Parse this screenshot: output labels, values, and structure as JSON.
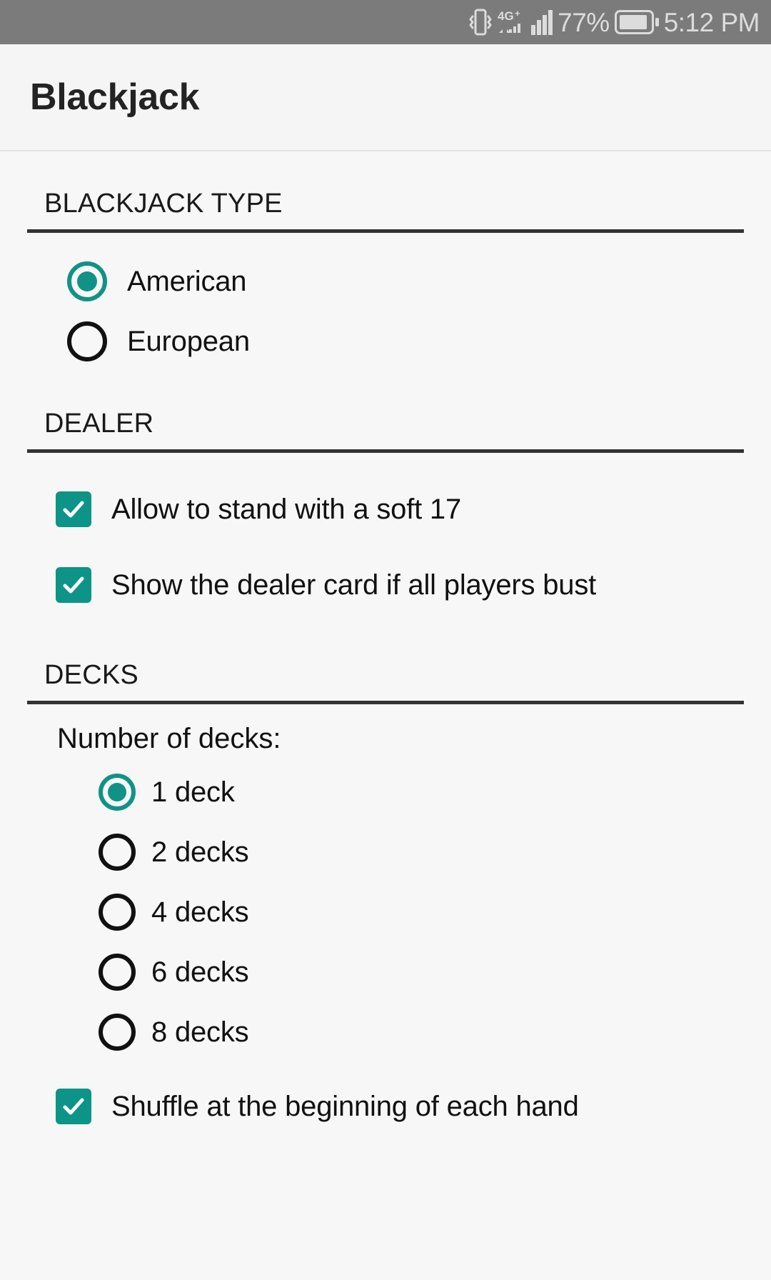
{
  "status_bar": {
    "icons": [
      "vibrate-icon",
      "network-4g-plus-icon",
      "signal-bars-icon",
      "battery-icon"
    ],
    "network_label": "4G",
    "network_superscript": "+",
    "battery_percent": "77%",
    "time": "5:12 PM"
  },
  "app_bar": {
    "title": "Blackjack"
  },
  "sections": {
    "blackjack_type": {
      "header": "BLACKJACK TYPE",
      "options": [
        {
          "label": "American",
          "selected": true
        },
        {
          "label": "European",
          "selected": false
        }
      ]
    },
    "dealer": {
      "header": "DEALER",
      "options": [
        {
          "label": "Allow to stand with a soft 17",
          "checked": true
        },
        {
          "label": "Show the dealer card if all players bust",
          "checked": true
        }
      ]
    },
    "decks": {
      "header": "DECKS",
      "number_label": "Number of decks:",
      "options": [
        {
          "label": "1 deck",
          "selected": true
        },
        {
          "label": "2 decks",
          "selected": false
        },
        {
          "label": "4 decks",
          "selected": false
        },
        {
          "label": "6 decks",
          "selected": false
        },
        {
          "label": "8 decks",
          "selected": false
        }
      ],
      "shuffle": {
        "label": "Shuffle at the beginning of each hand",
        "checked": true
      }
    }
  },
  "colors": {
    "accent_teal": "#0d9488",
    "radio_teal": "#109386",
    "status_bar_bg": "#7b7b7b",
    "page_bg": "#f7f7f7",
    "rule": "#333333"
  }
}
